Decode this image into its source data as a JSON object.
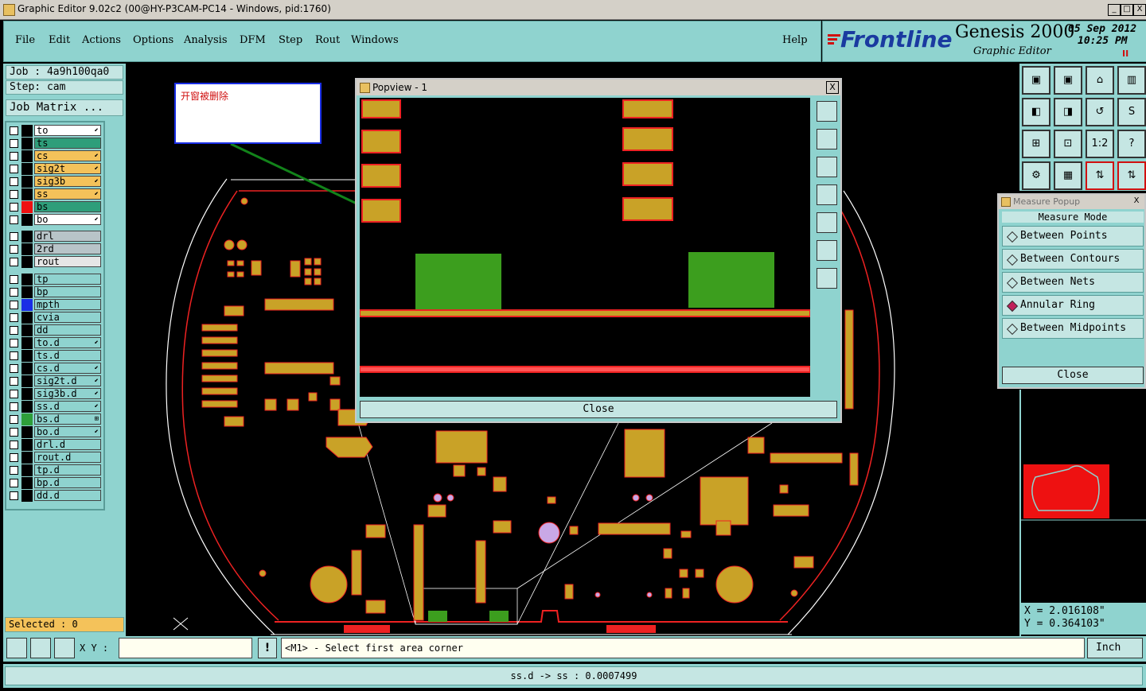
{
  "window": {
    "title": "Graphic Editor 9.02c2 (00@HY-P3CAM-PC14 - Windows, pid:1760)",
    "min_label": "_",
    "max_label": "□",
    "close_label": "X"
  },
  "menu": {
    "items": [
      "File",
      "Edit",
      "Actions",
      "Options",
      "Analysis",
      "DFM",
      "Step",
      "Rout",
      "Windows"
    ],
    "help": "Help"
  },
  "brand": {
    "logo": "Frontline",
    "product": "Genesis 2000",
    "subtitle": "Graphic Editor",
    "date": "05 Sep 2012",
    "time": "10:25 PM",
    "pause": "II"
  },
  "job": {
    "job_label": "Job : 4a9h100qa0",
    "step_label": "Step: cam",
    "matrix_button": "Job Matrix ..."
  },
  "layers_group1": [
    {
      "name": "to",
      "bg": "#ffffff",
      "sw": "#000000",
      "mark": "⬋"
    },
    {
      "name": "ts",
      "bg": "#2e9e7a",
      "sw": "#000000",
      "mark": ""
    },
    {
      "name": "cs",
      "bg": "#f4c25a",
      "sw": "#000000",
      "mark": "⬋"
    },
    {
      "name": "sig2t",
      "bg": "#f4c25a",
      "sw": "#000000",
      "mark": "⬋"
    },
    {
      "name": "sig3b",
      "bg": "#f4c25a",
      "sw": "#000000",
      "mark": "⬋"
    },
    {
      "name": "ss",
      "bg": "#f4c25a",
      "sw": "#000000",
      "mark": "⬋"
    },
    {
      "name": "bs",
      "bg": "#2e9e7a",
      "sw": "#ee1111",
      "mark": ""
    },
    {
      "name": "bo",
      "bg": "#ffffff",
      "sw": "#000000",
      "mark": "⬋"
    }
  ],
  "layers_group2": [
    {
      "name": "drl",
      "bg": "#b8c4c8",
      "sw": "#000000",
      "mark": ""
    },
    {
      "name": "2rd",
      "bg": "#b8c4c8",
      "sw": "#000000",
      "mark": ""
    },
    {
      "name": "rout",
      "bg": "#e6e6e6",
      "sw": "#000000",
      "mark": ""
    }
  ],
  "layers_group3": [
    {
      "name": "tp",
      "bg": "#8fd3cf",
      "sw": "#000000",
      "mark": ""
    },
    {
      "name": "bp",
      "bg": "#8fd3cf",
      "sw": "#000000",
      "mark": ""
    },
    {
      "name": "mpth",
      "bg": "#8fd3cf",
      "sw": "#1a2ee6",
      "mark": ""
    },
    {
      "name": "cvia",
      "bg": "#8fd3cf",
      "sw": "#000000",
      "mark": ""
    },
    {
      "name": "dd",
      "bg": "#8fd3cf",
      "sw": "#000000",
      "mark": ""
    },
    {
      "name": "to.d",
      "bg": "#8fd3cf",
      "sw": "#000000",
      "mark": "⬋"
    },
    {
      "name": "ts.d",
      "bg": "#8fd3cf",
      "sw": "#000000",
      "mark": ""
    },
    {
      "name": "cs.d",
      "bg": "#8fd3cf",
      "sw": "#000000",
      "mark": "⬋"
    },
    {
      "name": "sig2t.d",
      "bg": "#8fd3cf",
      "sw": "#000000",
      "mark": "⬋"
    },
    {
      "name": "sig3b.d",
      "bg": "#8fd3cf",
      "sw": "#000000",
      "mark": "⬋"
    },
    {
      "name": "ss.d",
      "bg": "#8fd3cf",
      "sw": "#000000",
      "mark": "⬋"
    },
    {
      "name": "bs.d",
      "bg": "#8fd3cf",
      "sw": "#2e9e3a",
      "mark": "⊞"
    },
    {
      "name": "bo.d",
      "bg": "#8fd3cf",
      "sw": "#000000",
      "mark": "⬋"
    },
    {
      "name": "drl.d",
      "bg": "#8fd3cf",
      "sw": "#000000",
      "mark": ""
    },
    {
      "name": "rout.d",
      "bg": "#8fd3cf",
      "sw": "#000000",
      "mark": ""
    },
    {
      "name": "tp.d",
      "bg": "#8fd3cf",
      "sw": "#000000",
      "mark": ""
    },
    {
      "name": "bp.d",
      "bg": "#8fd3cf",
      "sw": "#000000",
      "mark": ""
    },
    {
      "name": "dd.d",
      "bg": "#8fd3cf",
      "sw": "#000000",
      "mark": ""
    }
  ],
  "selected": "Selected : 0",
  "annotation": "开窗被删除",
  "popview": {
    "title": "Popview - 1",
    "close": "Close",
    "close_x": "X"
  },
  "measure": {
    "title": "Measure Popup",
    "mode_label": "Measure Mode",
    "options": [
      "Between Points",
      "Between Contours",
      "Between Nets",
      "Annular Ring",
      "Between Midpoints"
    ],
    "selected_index": 3,
    "close": "Close",
    "close_x": "X"
  },
  "tools": [
    "▣",
    "▣",
    "⌂",
    "▥",
    "◧",
    "◨",
    "↺",
    "S",
    "⊞",
    "⊡",
    "1:2",
    "?",
    "⚙",
    "▦",
    "⇅",
    "⇅"
  ],
  "coords": {
    "x": "X = 2.016108\"",
    "y": "Y = 0.364103\""
  },
  "command": {
    "xy_label": "X Y :",
    "xy_value": "",
    "info_icon": "!",
    "prompt": "<M1> - Select first area corner",
    "unit": "Inch"
  },
  "status": "ss.d -> ss : 0.0007499",
  "colors": {
    "panel": "#8fd3cf",
    "copper": "#c9a227",
    "outline": "#ee2222",
    "pad_green": "#3c9e1e"
  }
}
